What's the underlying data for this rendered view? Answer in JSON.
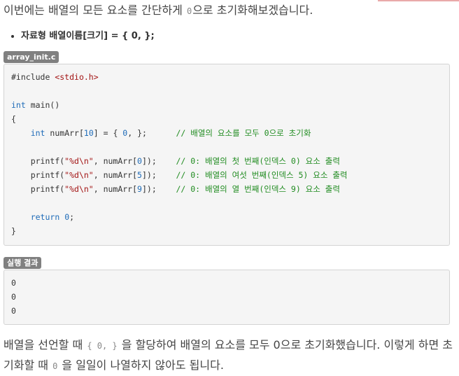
{
  "intro": {
    "text_before": "이번에는 배열의 모든 요소를 간단하게",
    "code": "0",
    "text_after": "으로 초기화해보겠습니다."
  },
  "bullets": [
    "자료형 배열이름[크기] = { 0, };"
  ],
  "file_tag": "array_init.c",
  "code": {
    "include_kw": "#include",
    "include_header": "<stdio.h>",
    "int_kw": "int",
    "main_sig": "main()",
    "open_brace": "{",
    "close_brace": "}",
    "decl_type": "int",
    "decl_name": "numArr[",
    "decl_size": "10",
    "decl_mid": "] = { ",
    "decl_value": "0",
    "decl_end": ", };",
    "decl_comment": "// 배열의 요소를 모두 0으로 초기화",
    "print_fn": "printf(",
    "print_fmt": "\"%d\\n\"",
    "print_arg_pre": ", numArr[",
    "print_arg_post": "]);",
    "print_idx": [
      "0",
      "5",
      "9"
    ],
    "print_comments": [
      "// 0: 배열의 첫 번째(인덱스 0) 요소 출력",
      "// 0: 배열의 여섯 번째(인덱스 5) 요소 출력",
      "// 0: 배열의 열 번째(인덱스 9) 요소 출력"
    ],
    "return_kw": "return",
    "return_value": "0",
    "return_end": ";"
  },
  "result_tag": "실행 결과",
  "output_lines": [
    "0",
    "0",
    "0"
  ],
  "outro": {
    "text_before": "배열을 선언할 때",
    "code_1": "{ 0, }",
    "text_mid": "을 할당하여 배열의 요소를 모두 0으로 초기화했습니다. 이렇게 하면 초기화할 때",
    "code_2": "0",
    "text_after": "을 일일이 나열하지 않아도 됩니다."
  }
}
